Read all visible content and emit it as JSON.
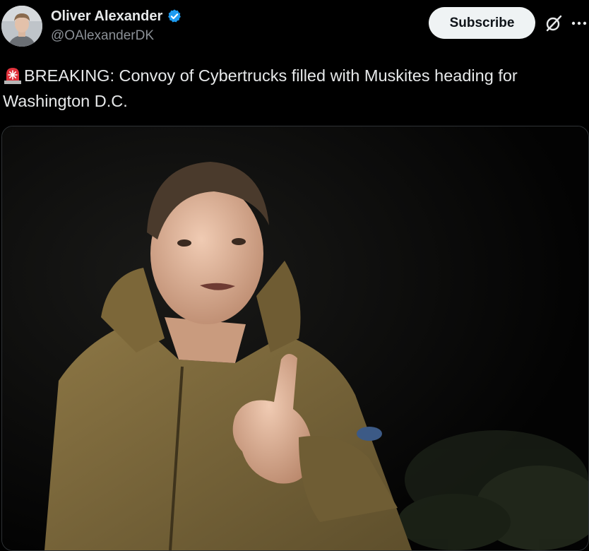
{
  "author": {
    "display_name": "Oliver Alexander",
    "handle": "@OAlexanderDK",
    "verified": true,
    "verified_color": "#1d9bf0"
  },
  "actions": {
    "subscribe_label": "Subscribe",
    "grok_icon": "grok-icon",
    "more_icon": "more-icon"
  },
  "tweet": {
    "emoji": "siren-icon",
    "text": "BREAKING: Convoy of Cybertrucks filled with Muskites heading for Washington D.C."
  },
  "media": {
    "type": "photo"
  },
  "colors": {
    "background": "#000000",
    "text": "#e7e9ea",
    "secondary_text": "#8b9096",
    "subscribe_bg": "#eff3f4"
  }
}
